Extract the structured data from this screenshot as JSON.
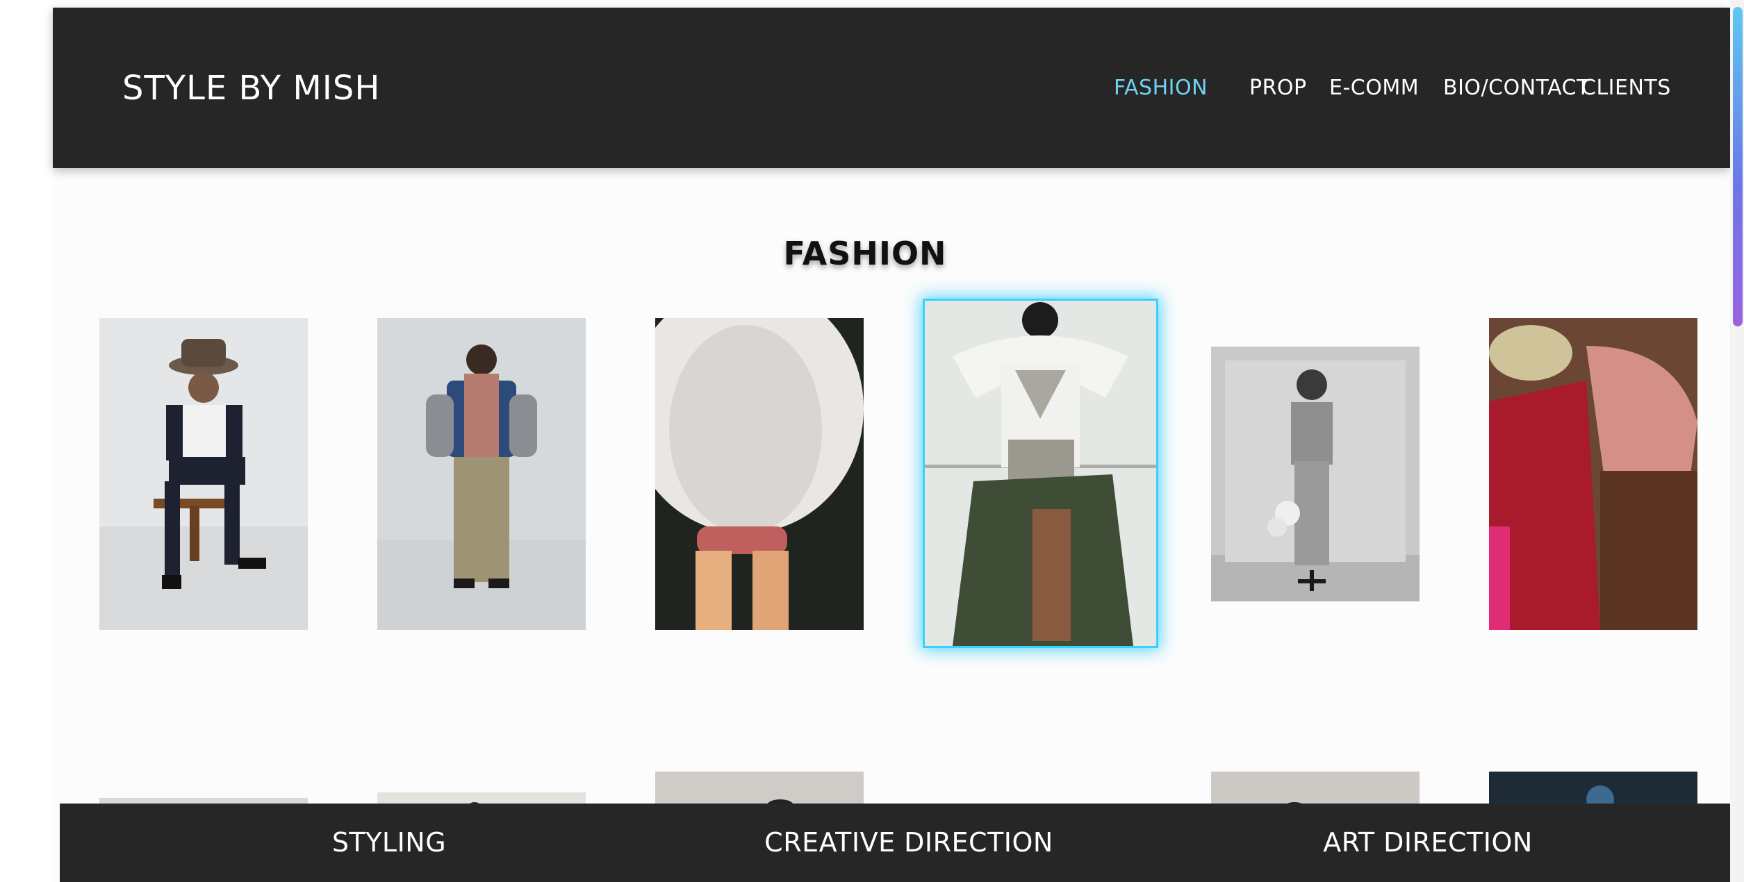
{
  "header": {
    "logo": "STYLE BY MISH",
    "nav": [
      {
        "label": "FASHION",
        "active": true
      },
      {
        "label": "PROP",
        "active": false
      },
      {
        "label": "E-COMM",
        "active": false
      },
      {
        "label": "BIO/CONTACT",
        "active": false
      },
      {
        "label": "CLIENTS",
        "active": false
      }
    ]
  },
  "main": {
    "section_title": "FASHION"
  },
  "gallery": {
    "row1": [
      {
        "icon": "photo-man-hats-chair"
      },
      {
        "icon": "photo-woman-pink-dress-vest"
      },
      {
        "icon": "photo-blurred-white-top"
      },
      {
        "icon": "photo-back-view-green-skirt",
        "highlighted": true
      },
      {
        "icon": "photo-bw-woman-plush-bag"
      },
      {
        "icon": "photo-red-satin-dress-embrace"
      }
    ]
  },
  "bottom_bar": {
    "items": [
      "STYLING",
      "CREATIVE DIRECTION",
      "ART DIRECTION"
    ]
  },
  "colors": {
    "header_bg": "#262626",
    "accent": "#6fd3f1",
    "highlight": "#3bcfff"
  }
}
